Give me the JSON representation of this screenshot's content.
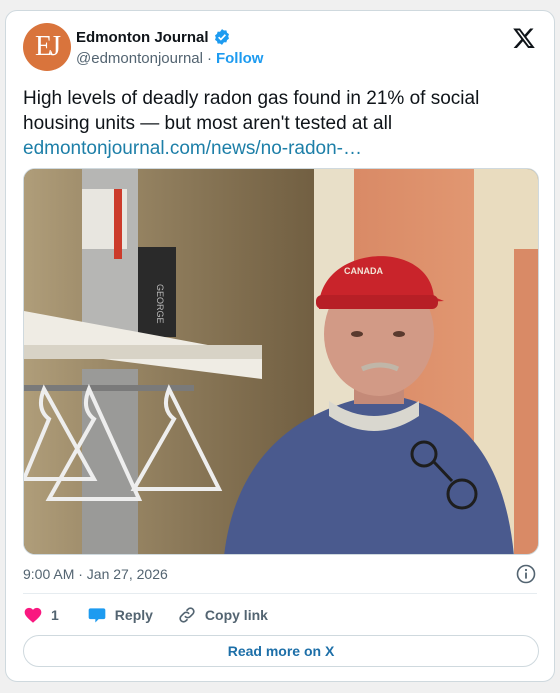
{
  "header": {
    "avatar_initials": "EJ",
    "display_name": "Edmonton Journal",
    "handle": "@edmontonjournal",
    "separator": "·",
    "follow_label": "Follow",
    "verified_icon": "verified-badge-icon",
    "platform_icon": "x-logo-icon"
  },
  "tweet": {
    "text": "High levels of deadly radon gas found in 21% of social housing units — but most aren't tested at all",
    "link": "edmontonjournal.com/news/no-radon-…"
  },
  "photo": {
    "cap_text": "CANADA",
    "box_text": "GEORGE"
  },
  "footer": {
    "timestamp": "9:00 AM · Jan 27, 2026",
    "like_count": "1",
    "reply_label": "Reply",
    "copy_label": "Copy link",
    "read_more_label": "Read more on X"
  },
  "colors": {
    "avatar": "#d9743c",
    "follow": "#1d9bf0",
    "link": "#1d7fa8",
    "like": "#f91880",
    "reply": "#1d9bf0"
  }
}
